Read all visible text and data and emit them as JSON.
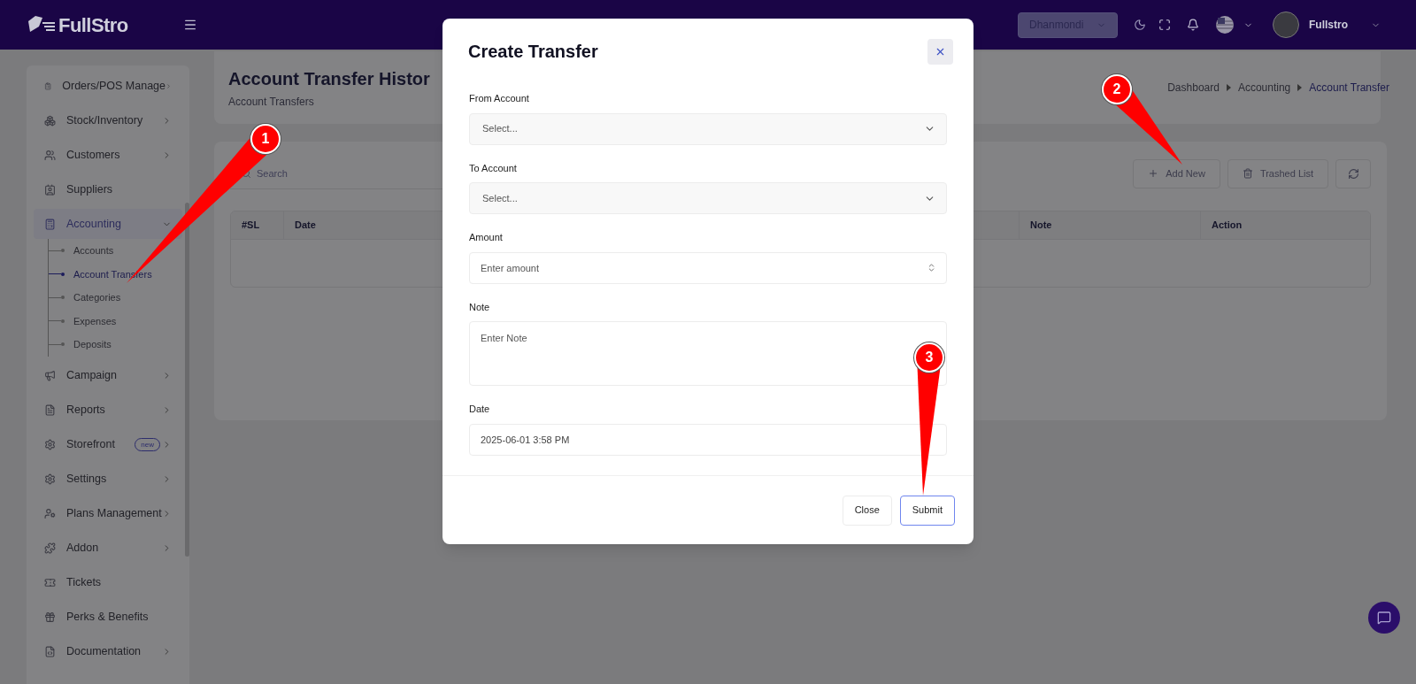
{
  "topbar": {
    "logo": "FullStro",
    "branch": "Dhanmondi",
    "user": "Fullstro"
  },
  "sidebar": {
    "items": [
      {
        "label": "Orders/POS Manage",
        "kind": "group",
        "expanded": false
      },
      {
        "label": "Stock/Inventory",
        "kind": "group",
        "expanded": false
      },
      {
        "label": "Customers",
        "kind": "group",
        "expanded": false
      },
      {
        "label": "Suppliers",
        "kind": "link",
        "expanded": false
      },
      {
        "label": "Accounting",
        "kind": "group",
        "expanded": true,
        "children": [
          {
            "label": "Accounts",
            "selected": false
          },
          {
            "label": "Account Transfers",
            "selected": true
          },
          {
            "label": "Categories",
            "selected": false
          },
          {
            "label": "Expenses",
            "selected": false
          },
          {
            "label": "Deposits",
            "selected": false
          }
        ]
      },
      {
        "label": "Campaign",
        "kind": "group",
        "expanded": false
      },
      {
        "label": "Reports",
        "kind": "group",
        "expanded": false
      },
      {
        "label": "Storefront",
        "kind": "group",
        "expanded": false,
        "badge": "new"
      },
      {
        "label": "Settings",
        "kind": "group",
        "expanded": false
      },
      {
        "label": "Plans Management",
        "kind": "group",
        "expanded": false
      },
      {
        "label": "Addon",
        "kind": "group",
        "expanded": false
      },
      {
        "label": "Tickets",
        "kind": "link",
        "expanded": false
      },
      {
        "label": "Perks & Benefits",
        "kind": "link",
        "expanded": false
      },
      {
        "label": "Documentation",
        "kind": "group",
        "expanded": false
      }
    ]
  },
  "page": {
    "title": "Account Transfer Histor",
    "subtitle": "Account Transfers",
    "breadcrumb": [
      "Dashboard",
      "Accounting",
      "Account Transfer"
    ]
  },
  "toolbar": {
    "search": {
      "placeholder": "Search"
    },
    "buttons": [
      "Add New",
      "Trashed List"
    ]
  },
  "table": {
    "columns": [
      "#SL",
      "Date",
      "Note",
      "Action"
    ]
  },
  "modal": {
    "title": "Create Transfer",
    "fields": [
      {
        "label": "From Account",
        "kind": "select",
        "placeholder": "Select..."
      },
      {
        "label": "To Account",
        "kind": "select",
        "placeholder": "Select..."
      },
      {
        "label": "Amount",
        "kind": "number",
        "placeholder": "Enter amount"
      },
      {
        "label": "Note",
        "kind": "textarea",
        "placeholder": "Enter Note"
      },
      {
        "label": "Date",
        "kind": "text",
        "value": "2025-06-01 3:58 PM"
      }
    ],
    "buttons": [
      {
        "label": "Close",
        "primary": false
      },
      {
        "label": "Submit",
        "primary": true
      }
    ]
  },
  "annotations": [
    {
      "number": "1"
    },
    {
      "number": "2"
    },
    {
      "number": "3"
    }
  ]
}
